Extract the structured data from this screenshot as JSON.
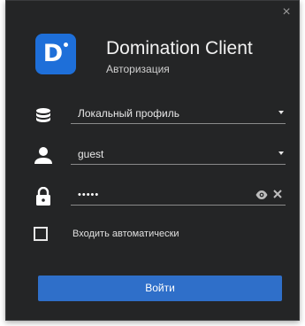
{
  "window": {
    "close_glyph": "×"
  },
  "header": {
    "logo_letter": "D",
    "title": "Domination Client",
    "subtitle": "Авторизация"
  },
  "form": {
    "profile": {
      "value": "Локальный профиль",
      "icon": "database-icon"
    },
    "username": {
      "value": "guest",
      "icon": "user-icon"
    },
    "password": {
      "masked_value": "•••••",
      "icon": "lock-icon",
      "show_icon": "eye-icon",
      "clear_icon": "close-icon"
    },
    "auto_login": {
      "label": "Входить автоматически",
      "checked": false
    },
    "submit_label": "Войти"
  },
  "colors": {
    "background": "#242526",
    "accent": "#2f6fc9",
    "logo": "#1e6fd9",
    "text": "#e6e6e6"
  }
}
